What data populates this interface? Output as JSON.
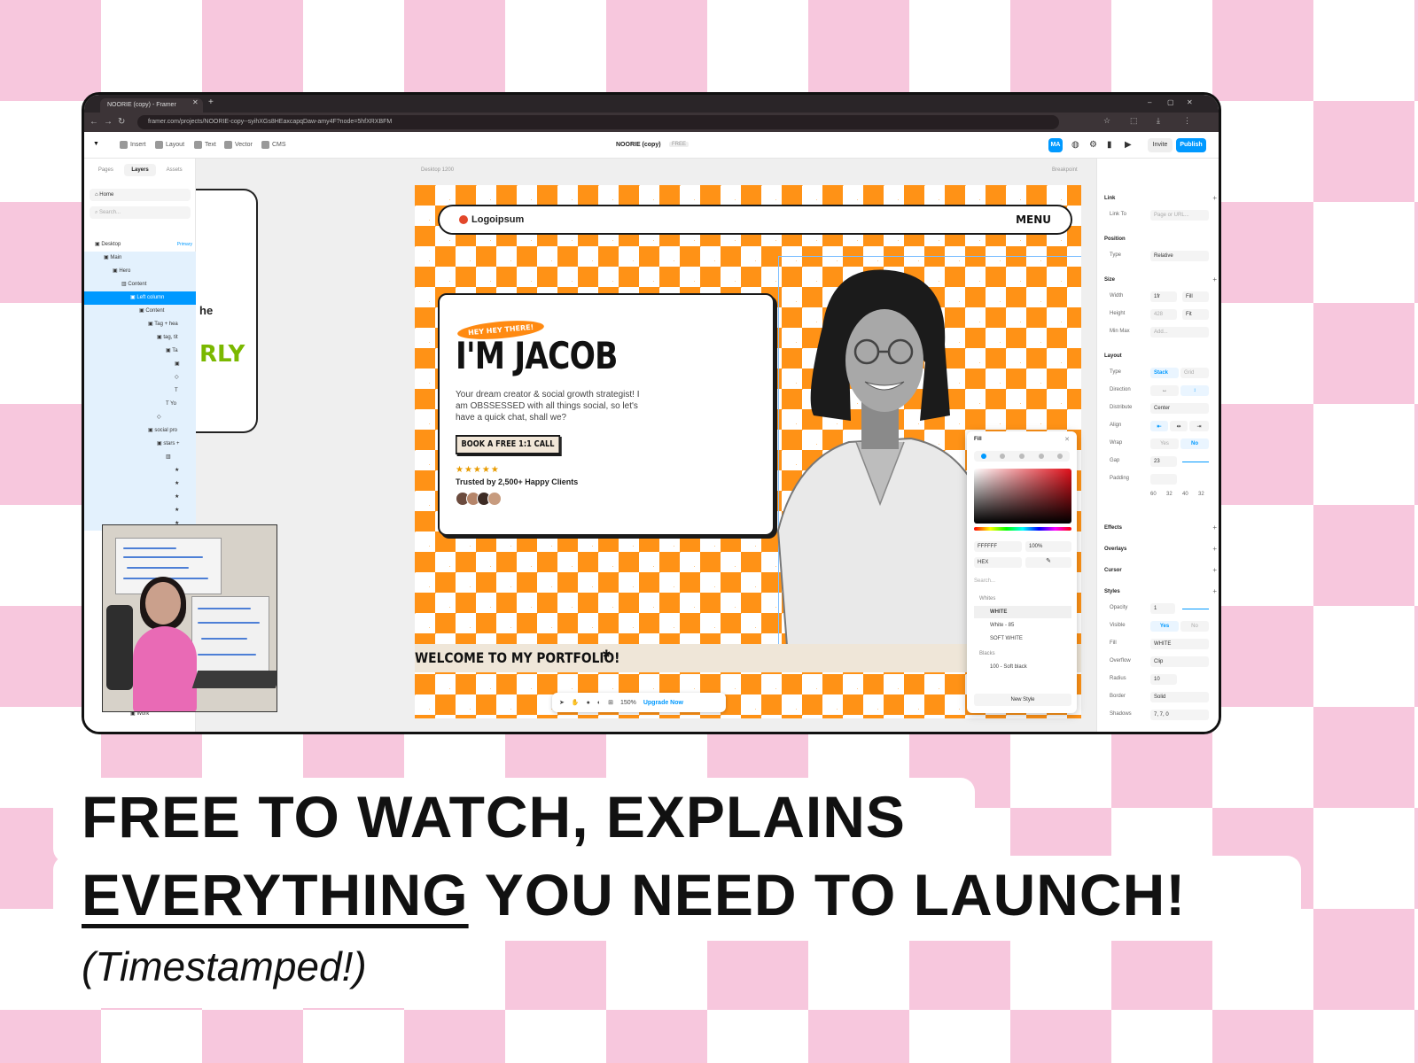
{
  "colors": {
    "accent": "#0099ff",
    "site_orange": "#ff9216",
    "pink": "#f7c7dd",
    "green_text": "#7ab800"
  },
  "browser": {
    "tab_title": "NOORIE (copy) - Framer",
    "url": "framer.com/projects/NOORIE-copy--syihXGs8HEaxcapqDaw-amy4F?node=5hfXRXBFM"
  },
  "toolbar": {
    "insert": "Insert",
    "layout": "Layout",
    "text": "Text",
    "vector": "Vector",
    "cms": "CMS",
    "project_title": "NOORIE (copy)",
    "plan_badge": "FREE",
    "avatar_initials": "MA",
    "invite": "Invite",
    "publish": "Publish"
  },
  "left_panel": {
    "tabs": [
      "Pages",
      "Layers",
      "Assets"
    ],
    "page_select": "Home",
    "search_placeholder": "Search...",
    "layers": [
      {
        "label": "Desktop",
        "badge": "Primary"
      },
      {
        "label": "Main"
      },
      {
        "label": "Hero"
      },
      {
        "label": "Content"
      },
      {
        "label": "Left column"
      },
      {
        "label": "Content"
      },
      {
        "label": "Tag + hea"
      },
      {
        "label": "tag, tit"
      },
      {
        "label": "Ta"
      },
      {
        "label": "Yo"
      },
      {
        "label": "social pro"
      },
      {
        "label": "stars +"
      },
      {
        "label": "Work"
      }
    ],
    "ghost_text": "he",
    "ghost_green": "RLY"
  },
  "canvas": {
    "frame_label": "Desktop 1200",
    "breakpoint_label": "Breakpoint",
    "zoom": "150%",
    "upgrade": "Upgrade Now"
  },
  "site": {
    "logo": "Logoipsum",
    "menu": "MENU",
    "tag": "HEY HEY THERE!",
    "headline": "I'M JACOB",
    "description": "Your dream creator & social growth strategist! I am OBSSESSED with all things social, so let's have a quick chat, shall we?",
    "cta": "BOOK A FREE 1:1 CALL",
    "rating": "★★★★★",
    "trusted": "Trusted by 2,500+ Happy Clients",
    "welcome": "WELCOME TO MY PORTFOLIO!",
    "asterisk": "*"
  },
  "fill_popup": {
    "title": "Fill",
    "hex_value": "FFFFFF",
    "opacity": "100%",
    "format": "HEX",
    "search_placeholder": "Search...",
    "groups": [
      "Whites",
      "Blacks"
    ],
    "styles": [
      "WHITE",
      "White - 85",
      "SOFT WHITE",
      "100 - Soft black"
    ],
    "new_style": "New Style"
  },
  "right_panel": {
    "link": {
      "title": "Link",
      "link_to": "Link To",
      "placeholder": "Page or URL..."
    },
    "position": {
      "title": "Position",
      "type_label": "Type",
      "type": "Relative"
    },
    "size": {
      "title": "Size",
      "width_label": "Width",
      "width": "1fr",
      "width_mode": "Fill",
      "height_label": "Height",
      "height": "428",
      "height_mode": "Fit",
      "minmax_label": "Min Max",
      "minmax": "Add..."
    },
    "layout": {
      "title": "Layout",
      "type_label": "Type",
      "stack": "Stack",
      "grid": "Grid",
      "direction_label": "Direction",
      "distribute_label": "Distribute",
      "distribute": "Center",
      "align_label": "Align",
      "wrap_label": "Wrap",
      "wrap_yes": "Yes",
      "wrap_no": "No",
      "gap_label": "Gap",
      "gap": "23",
      "padding_label": "Padding",
      "padding_values": [
        "60",
        "32",
        "40",
        "32"
      ]
    },
    "effects": "Effects",
    "overlays": "Overlays",
    "cursor": "Cursor",
    "styles": {
      "title": "Styles",
      "opacity_label": "Opacity",
      "opacity": "1",
      "visible_label": "Visible",
      "visible_yes": "Yes",
      "visible_no": "No",
      "fill_label": "Fill",
      "fill": "WHITE",
      "overflow_label": "Overflow",
      "overflow": "Clip",
      "radius_label": "Radius",
      "radius": "10",
      "border_label": "Border",
      "border": "Solid",
      "shadows_label": "Shadows",
      "shadows": "7, 7, 0"
    }
  },
  "caption": {
    "line1": "FREE TO WATCH, EXPLAINS",
    "line2_underlined": "EVERYTHING",
    "line2_rest": " YOU NEED TO LAUNCH!",
    "line3": "(Timestamped!)"
  }
}
